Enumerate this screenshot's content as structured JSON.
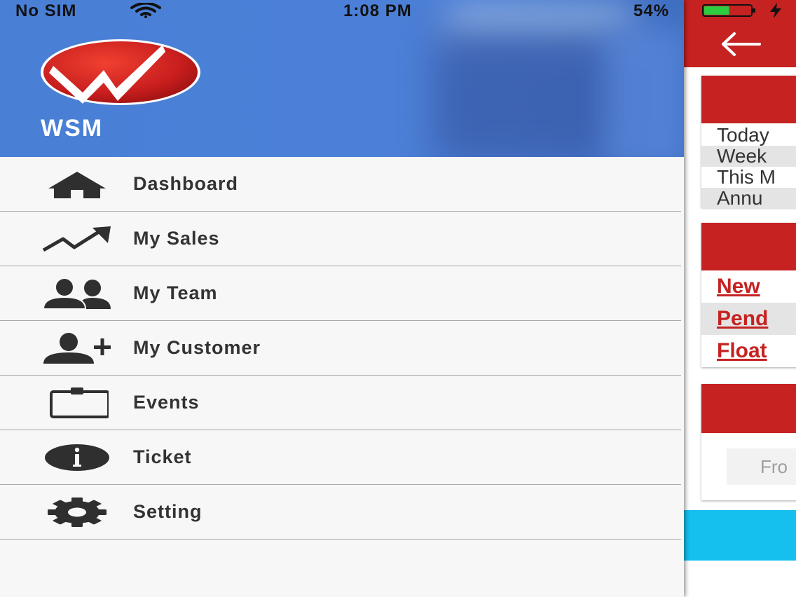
{
  "status_bar": {
    "carrier": "No SIM",
    "time": "1:08 PM",
    "battery_percent": "54%",
    "battery_level": 0.54,
    "battery_color": "#2ecc40"
  },
  "drawer": {
    "brand": "WSM",
    "items": [
      {
        "label": "Dashboard",
        "icon": "home-icon"
      },
      {
        "label": "My Sales",
        "icon": "trend-up-icon"
      },
      {
        "label": "My Team",
        "icon": "team-icon"
      },
      {
        "label": "My Customer",
        "icon": "add-user-icon"
      },
      {
        "label": "Events",
        "icon": "clipboard-icon"
      },
      {
        "label": "Ticket",
        "icon": "info-icon"
      },
      {
        "label": "Setting",
        "icon": "gear-icon"
      }
    ]
  },
  "app": {
    "sales_rows": [
      "Today",
      "Week",
      "This M",
      "Annu"
    ],
    "link_rows": [
      "New",
      "Pend",
      "Float"
    ],
    "date_placeholder": "Fro"
  },
  "colors": {
    "primary_red": "#c62222",
    "header_blue": "#4c80d8",
    "cyan": "#16c0ee",
    "menu_text": "#333333"
  }
}
